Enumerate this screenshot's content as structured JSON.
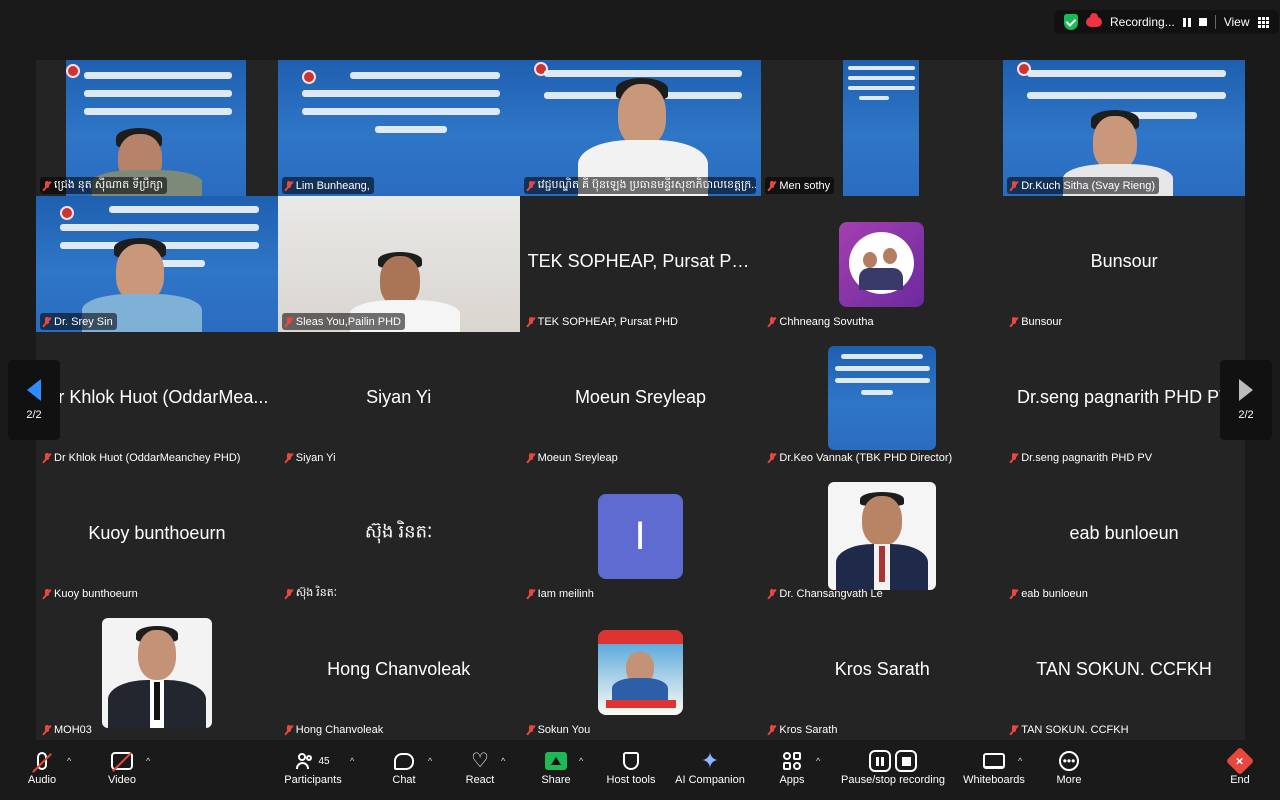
{
  "topbar": {
    "recording_label": "Recording...",
    "view_label": "View"
  },
  "gallery": {
    "page_indicator": "2/2",
    "tiles": [
      {
        "id": "t1",
        "label": "ជ្រេង នុត សុីណាត ទីប្រឹក្សា",
        "display": ""
      },
      {
        "id": "t2",
        "label": "Lim Bunheang,",
        "display": ""
      },
      {
        "id": "t3",
        "label": "វេជ្ជបណ្ឌិត គី ប៊ុនឡេង ប្រធានមន្ទីរសុខាភិបាលខេត្តក្រ...",
        "display": ""
      },
      {
        "id": "t4",
        "label": "Men sothy",
        "display": ""
      },
      {
        "id": "t5",
        "label": "Dr.Kuch Sitha (Svay Rieng)",
        "display": ""
      },
      {
        "id": "t6",
        "label": "Dr. Srey Sin",
        "display": ""
      },
      {
        "id": "t7",
        "label": "Sleas You,Pailin PHD",
        "display": ""
      },
      {
        "id": "t8",
        "label": "TEK SOPHEAP, Pursat PHD",
        "display": "TEK SOPHEAP, Pursat PHD"
      },
      {
        "id": "t9",
        "label": "Chhneang Sovutha",
        "display": ""
      },
      {
        "id": "t10",
        "label": "Bunsour",
        "display": "Bunsour"
      },
      {
        "id": "t11",
        "label": "Dr Khlok Huot (OddarMeanchey PHD)",
        "display": "Dr Khlok Huot (OddarMea..."
      },
      {
        "id": "t12",
        "label": "Siyan Yi",
        "display": "Siyan Yi"
      },
      {
        "id": "t13",
        "label": "Moeun Sreyleap",
        "display": "Moeun Sreyleap"
      },
      {
        "id": "t14",
        "label": "Dr.Keo Vannak (TBK PHD Director)",
        "display": ""
      },
      {
        "id": "t15",
        "label": "Dr.seng pagnarith PHD PV",
        "display": "Dr.seng pagnarith PHD PV"
      },
      {
        "id": "t16",
        "label": "Kuoy bunthoeurn",
        "display": "Kuoy bunthoeurn"
      },
      {
        "id": "t17",
        "label": "ស៊ុង រិនតៈ",
        "display": "ស៊ុង រិនតៈ"
      },
      {
        "id": "t18",
        "label": "Iam meilinh",
        "display": "",
        "avatar_letter": "I"
      },
      {
        "id": "t19",
        "label": "Dr. Chansangvath Le",
        "display": ""
      },
      {
        "id": "t20",
        "label": "eab bunloeun",
        "display": "eab bunloeun"
      },
      {
        "id": "t21",
        "label": "MOH03",
        "display": ""
      },
      {
        "id": "t22",
        "label": "Hong Chanvoleak",
        "display": "Hong Chanvoleak"
      },
      {
        "id": "t23",
        "label": "Sokun You",
        "display": ""
      },
      {
        "id": "t24",
        "label": "Kros Sarath",
        "display": "Kros Sarath"
      },
      {
        "id": "t25",
        "label": "TAN SOKUN.   CCFKH",
        "display": "TAN SOKUN.   CCFKH"
      }
    ]
  },
  "toolbar": {
    "audio": "Audio",
    "video": "Video",
    "participants": "Participants",
    "participants_count": "45",
    "chat": "Chat",
    "react": "React",
    "share": "Share",
    "host_tools": "Host tools",
    "ai_companion": "AI Companion",
    "apps": "Apps",
    "pause_stop_recording": "Pause/stop recording",
    "whiteboards": "Whiteboards",
    "more": "More",
    "end": "End"
  },
  "colors": {
    "background": "#1a1a1a",
    "tile_background": "#242424",
    "muted_red": "#e8483c",
    "accent_blue": "#2d8cff",
    "share_green": "#1db954",
    "avatar_purple": "#5f6bd1",
    "banner_blue": "#2a6cc0"
  }
}
